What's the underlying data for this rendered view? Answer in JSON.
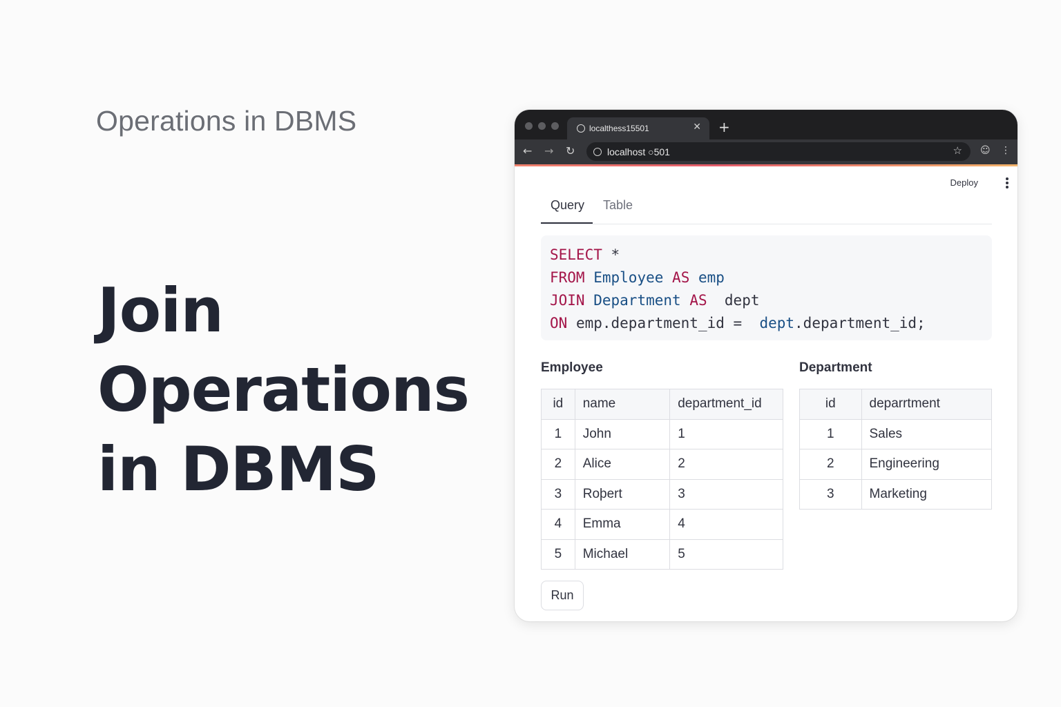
{
  "page": {
    "subtitle": "Operations in DBMS",
    "headline": [
      "Join",
      "Operations",
      "in DBMS"
    ]
  },
  "browser": {
    "tab_title": "localthess15501",
    "url": "localhost ○501",
    "tab_close": "✕",
    "new_tab": "+"
  },
  "app": {
    "deploy_label": "Deploy",
    "tabs": [
      {
        "label": "Query",
        "active": true
      },
      {
        "label": "Table",
        "active": false
      }
    ],
    "query_lines": [
      [
        {
          "t": "SELECT",
          "c": "kw"
        },
        {
          "t": " *",
          "c": ""
        }
      ],
      [
        {
          "t": "FROM",
          "c": "kw"
        },
        {
          "t": " ",
          "c": ""
        },
        {
          "t": "Employee",
          "c": "id"
        },
        {
          "t": " ",
          "c": ""
        },
        {
          "t": "AS",
          "c": "kw"
        },
        {
          "t": " ",
          "c": ""
        },
        {
          "t": "emp",
          "c": "id"
        }
      ],
      [
        {
          "t": "JOIN",
          "c": "kw"
        },
        {
          "t": " ",
          "c": ""
        },
        {
          "t": "Department",
          "c": "id"
        },
        {
          "t": " ",
          "c": ""
        },
        {
          "t": "AS",
          "c": "kw"
        },
        {
          "t": "  dept",
          "c": ""
        }
      ],
      [
        {
          "t": "ON",
          "c": "kw"
        },
        {
          "t": " emp.department_id =  ",
          "c": ""
        },
        {
          "t": "dept",
          "c": "id"
        },
        {
          "t": ".department_id;",
          "c": ""
        }
      ]
    ],
    "employee": {
      "title": "Employee",
      "columns": [
        "id",
        "name",
        "department_id"
      ],
      "rows": [
        [
          "1",
          "John",
          "1"
        ],
        [
          "2",
          "Alice",
          "2"
        ],
        [
          "3",
          "Roþert",
          "3"
        ],
        [
          "4",
          "Emma",
          "4"
        ],
        [
          "5",
          "Michael",
          "5"
        ]
      ]
    },
    "department": {
      "title": "Department",
      "columns": [
        "id",
        "deparrtment"
      ],
      "rows": [
        [
          "1",
          "Sales"
        ],
        [
          "2",
          "Engineering"
        ],
        [
          "3",
          "Marketing"
        ]
      ]
    },
    "run_label": "Run"
  },
  "colors": {
    "keyword": "#a31448",
    "identifier": "#194f85",
    "headline": "#222633"
  }
}
